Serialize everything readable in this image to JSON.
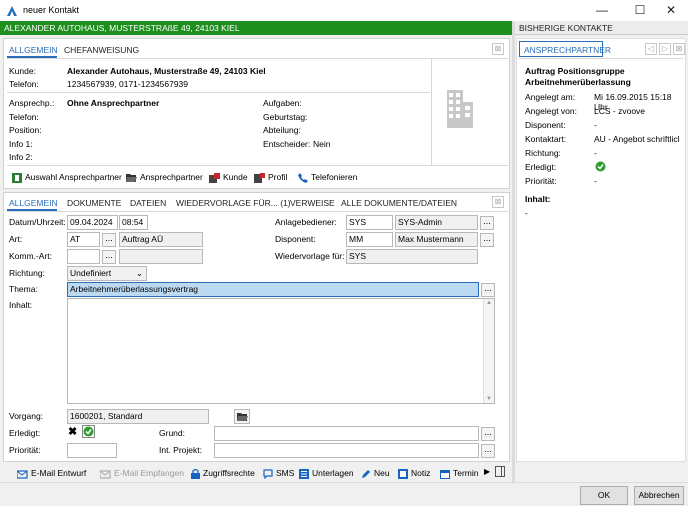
{
  "window": {
    "title": "neuer Kontakt",
    "minimize": "—",
    "maximize": "☐",
    "close": "✕"
  },
  "header": {
    "green_title": "ALEXANDER AUTOHAUS, MUSTERSTRAßE 49, 24103 KIEL",
    "right_title": "BISHERIGE KONTAKTE"
  },
  "top_tabs": [
    "ALLGEMEIN",
    "CHEFANWEISUNG"
  ],
  "kunde": {
    "kunde_label": "Kunde:",
    "kunde_value": "Alexander Autohaus, Musterstraße 49, 24103 Kiel",
    "telefon_label": "Telefon:",
    "telefon_value": "1234567939, 0171-1234567939",
    "ansprech_label": "Ansprechp.:",
    "ansprech_value": "Ohne Ansprechpartner",
    "telefon2_label": "Telefon:",
    "position_label": "Position:",
    "info1_label": "Info 1:",
    "info2_label": "Info 2:",
    "aufgaben_label": "Aufgaben:",
    "geburtstag_label": "Geburtstag:",
    "abteilung_label": "Abteilung:",
    "entscheider_label": "Entscheider:",
    "entscheider_value": "Nein"
  },
  "actions": {
    "auswahl": "Auswahl Ansprechpartner",
    "ansprechpartner": "Ansprechpartner",
    "kunde": "Kunde",
    "profil": "Profil",
    "telefonieren": "Telefonieren"
  },
  "detail_tabs": [
    "ALLGEMEIN",
    "DOKUMENTE",
    "DATEIEN",
    "WIEDERVORLAGE FÜR... (1)",
    "VERWEISE",
    "ALLE DOKUMENTE/DATEIEN"
  ],
  "form": {
    "datum_label": "Datum/Uhrzeit:",
    "datum_value": "09.04.2024",
    "uhrzeit_value": "08:54",
    "art_label": "Art:",
    "art_code": "AT",
    "art_value": "Auftrag AÜ",
    "komm_label": "Komm.-Art:",
    "richtung_label": "Richtung:",
    "richtung_value": "Undefiniert",
    "thema_label": "Thema:",
    "thema_value": "Arbeitnehmerüberlassungsvertrag",
    "inhalt_label": "Inhalt:",
    "anlage_label": "Anlagebediener:",
    "anlage_code": "SYS",
    "anlage_value": "SYS-Admin",
    "disponent_label": "Disponent:",
    "disponent_code": "MM",
    "disponent_value": "Max Mustermann",
    "wiedervorlage_label": "Wiedervorlage für:",
    "wiedervorlage_value": "SYS",
    "vorgang_label": "Vorgang:",
    "vorgang_value": "1600201, Standard",
    "erledigt_label": "Erledigt:",
    "prioritaet_label": "Priorität:",
    "grund_label": "Grund:",
    "intprojekt_label": "Int. Projekt:",
    "dots": "..."
  },
  "toolbar": [
    "E-Mail Entwurf",
    "E-Mail Empfangen",
    "Zugriffsrechte",
    "SMS",
    "Unterlagen",
    "Neu",
    "Notiz",
    "Termin"
  ],
  "buttons": {
    "ok": "OK",
    "abbrechen": "Abbrechen"
  },
  "right_panel": {
    "tab": "ANSPRECHPARTNER",
    "heading": "Auftrag Positionsgruppe Arbeitnehmerüberlassung",
    "rows": [
      {
        "label": "Angelegt am:",
        "value": "Mi 16.09.2015 15:18 Uhr"
      },
      {
        "label": "Angelegt von:",
        "value": "LCS - zvoove"
      },
      {
        "label": "Disponent:",
        "value": "-"
      },
      {
        "label": "Kontaktart:",
        "value": "AU - Angebot schriftlicl"
      },
      {
        "label": "Richtung:",
        "value": "-"
      },
      {
        "label": "Erledigt:",
        "value": ""
      },
      {
        "label": "Priorität:",
        "value": "-"
      }
    ],
    "inhalt_label": "Inhalt:",
    "inhalt_value": "-"
  },
  "colors": {
    "accent": "#2a6db8",
    "green": "#1e8e1e",
    "selection": "#bcd9f2"
  }
}
